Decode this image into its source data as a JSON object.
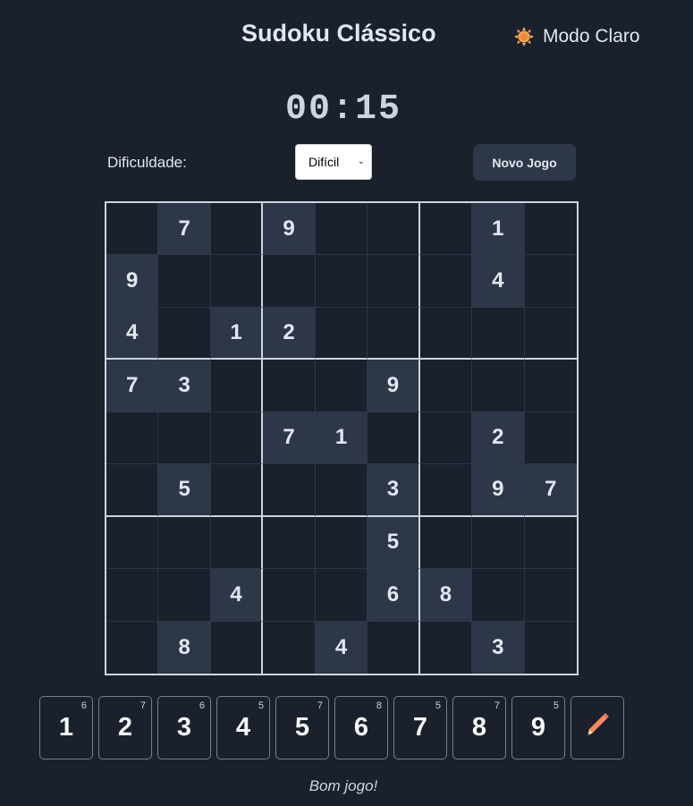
{
  "header": {
    "title": "Sudoku Clássico",
    "theme_toggle_label": "Modo Claro",
    "theme_icon": "sun-icon"
  },
  "timer": "00:15",
  "controls": {
    "difficulty_label": "Dificuldade:",
    "difficulty_value": "Difícil",
    "new_game_label": "Novo Jogo"
  },
  "board": [
    [
      "",
      "7",
      "",
      "9",
      "",
      "",
      "",
      "1",
      ""
    ],
    [
      "9",
      "",
      "",
      "",
      "",
      "",
      "",
      "4",
      ""
    ],
    [
      "4",
      "",
      "1",
      "2",
      "",
      "",
      "",
      "",
      ""
    ],
    [
      "7",
      "3",
      "",
      "",
      "",
      "9",
      "",
      "",
      ""
    ],
    [
      "",
      "",
      "",
      "7",
      "1",
      "",
      "",
      "2",
      ""
    ],
    [
      "",
      "5",
      "",
      "",
      "",
      "3",
      "",
      "9",
      "7"
    ],
    [
      "",
      "",
      "",
      "",
      "",
      "5",
      "",
      "",
      ""
    ],
    [
      "",
      "",
      "4",
      "",
      "",
      "6",
      "8",
      "",
      ""
    ],
    [
      "",
      "8",
      "",
      "",
      "4",
      "",
      "",
      "3",
      ""
    ]
  ],
  "numpad": [
    {
      "digit": "1",
      "count": "6"
    },
    {
      "digit": "2",
      "count": "7"
    },
    {
      "digit": "3",
      "count": "6"
    },
    {
      "digit": "4",
      "count": "5"
    },
    {
      "digit": "5",
      "count": "7"
    },
    {
      "digit": "6",
      "count": "8"
    },
    {
      "digit": "7",
      "count": "5"
    },
    {
      "digit": "8",
      "count": "7"
    },
    {
      "digit": "9",
      "count": "5"
    }
  ],
  "notes_icon": "pencil-icon",
  "status": "Bom jogo!",
  "colors": {
    "background": "#1a202c",
    "given_cell": "#2d3748",
    "text": "#e2e8f0",
    "pencil": "#f6895a"
  }
}
